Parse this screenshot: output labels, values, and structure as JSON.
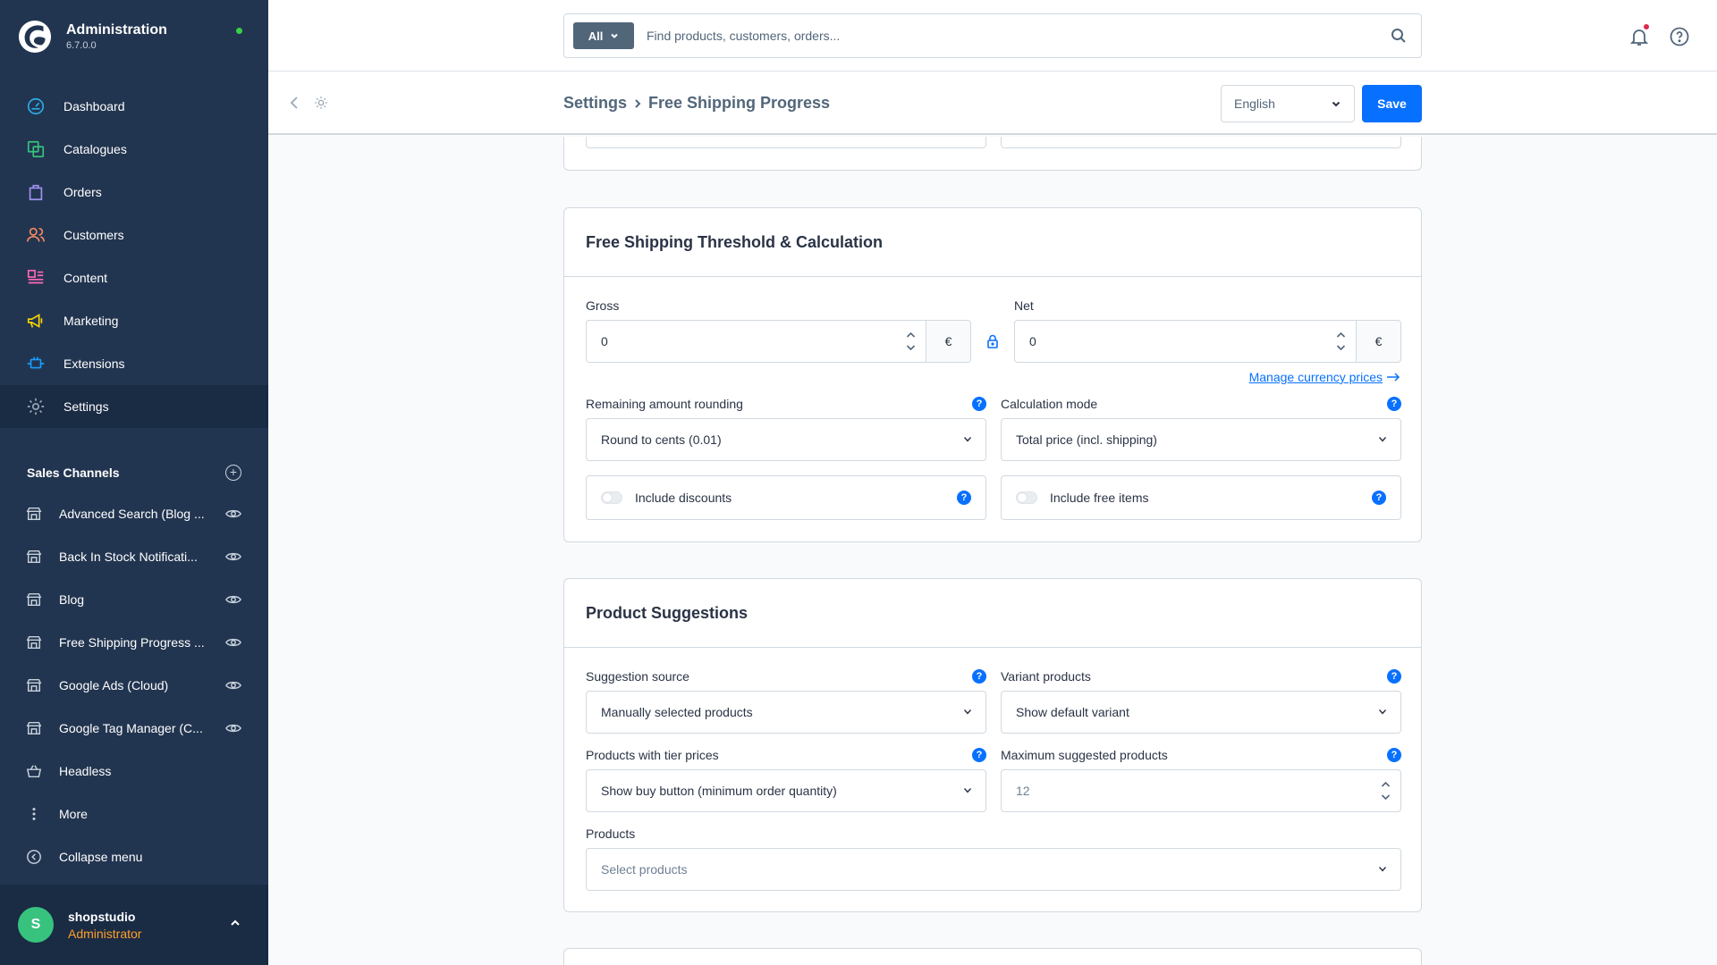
{
  "sidebar": {
    "brand_title": "Administration",
    "brand_version": "6.7.0.0",
    "nav": [
      {
        "label": "Dashboard",
        "icon": "dashboard-icon",
        "color": "#2dabe7"
      },
      {
        "label": "Catalogues",
        "icon": "catalogues-icon",
        "color": "#37c37d"
      },
      {
        "label": "Orders",
        "icon": "orders-icon",
        "color": "#a092f0"
      },
      {
        "label": "Customers",
        "icon": "customers-icon",
        "color": "#f88962"
      },
      {
        "label": "Content",
        "icon": "content-icon",
        "color": "#ff68b4"
      },
      {
        "label": "Marketing",
        "icon": "marketing-icon",
        "color": "#ffd700"
      },
      {
        "label": "Extensions",
        "icon": "extensions-icon",
        "color": "#189eff"
      },
      {
        "label": "Settings",
        "icon": "settings-icon",
        "color": "#9aa8b5"
      }
    ],
    "sales_channels_title": "Sales Channels",
    "sales_channels": [
      {
        "label": "Advanced Search (Blog ..."
      },
      {
        "label": "Back In Stock Notificati..."
      },
      {
        "label": "Blog"
      },
      {
        "label": "Free Shipping Progress ..."
      },
      {
        "label": "Google Ads (Cloud)"
      },
      {
        "label": "Google Tag Manager (C..."
      },
      {
        "label": "Headless"
      }
    ],
    "more_label": "More",
    "collapse_label": "Collapse menu",
    "user": {
      "initial": "S",
      "name": "shopstudio",
      "role": "Administrator"
    }
  },
  "topbar": {
    "search_type": "All",
    "search_placeholder": "Find products, customers, orders..."
  },
  "smartbar": {
    "crumb_root": "Settings",
    "crumb_page": "Free Shipping Progress",
    "language": "English",
    "save_label": "Save"
  },
  "threshold_card": {
    "title": "Free Shipping Threshold & Calculation",
    "gross_label": "Gross",
    "gross_value": "0",
    "net_label": "Net",
    "net_value": "0",
    "currency_symbol": "€",
    "manage_link": "Manage currency prices",
    "rounding_label": "Remaining amount rounding",
    "rounding_value": "Round to cents (0.01)",
    "calc_label": "Calculation mode",
    "calc_value": "Total price (incl. shipping)",
    "discounts_label": "Include discounts",
    "free_items_label": "Include free items",
    "help_glyph": "?"
  },
  "suggestions_card": {
    "title": "Product Suggestions",
    "source_label": "Suggestion source",
    "source_value": "Manually selected products",
    "variant_label": "Variant products",
    "variant_value": "Show default variant",
    "tier_label": "Products with tier prices",
    "tier_value": "Show buy button (minimum order quantity)",
    "max_label": "Maximum suggested products",
    "max_placeholder": "12",
    "products_label": "Products",
    "products_placeholder": "Select products"
  }
}
